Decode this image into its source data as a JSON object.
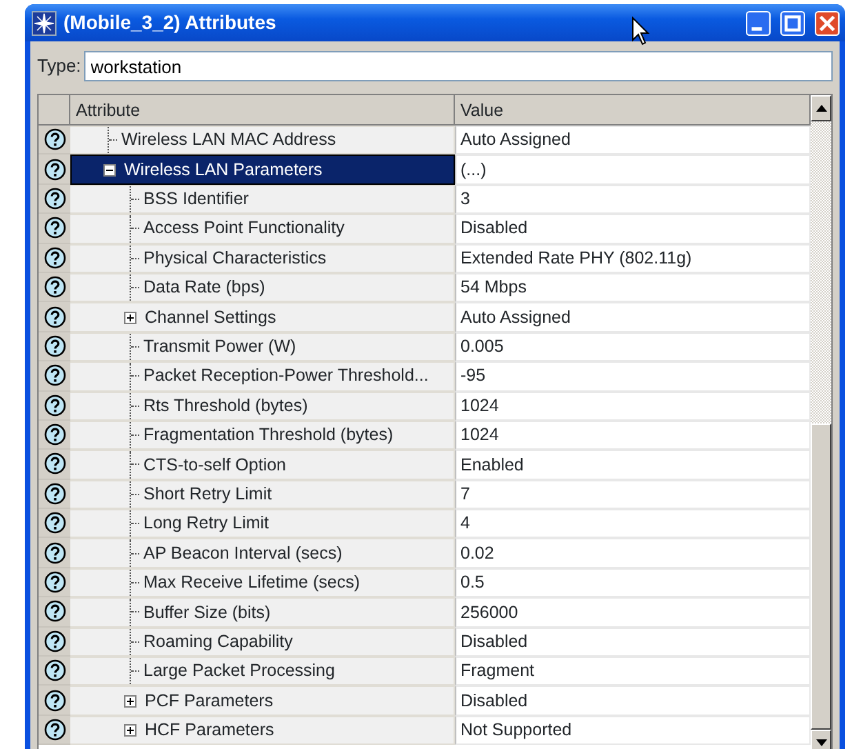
{
  "window": {
    "title": "(Mobile_3_2) Attributes"
  },
  "type_field": {
    "label": "Type:",
    "value": "workstation"
  },
  "table": {
    "columns": [
      "Attribute",
      "Value"
    ],
    "rows": [
      {
        "kind": "leaf",
        "name": "Wireless LAN MAC Address",
        "value": "Auto Assigned",
        "selected": false
      },
      {
        "kind": "group",
        "name": "Wireless LAN Parameters",
        "value": "(...)",
        "selected": true,
        "expanded": true,
        "children": [
          {
            "kind": "leaf",
            "name": "BSS Identifier",
            "value": "3",
            "selected": false
          },
          {
            "kind": "leaf",
            "name": "Access Point Functionality",
            "value": "Disabled",
            "selected": false
          },
          {
            "kind": "leaf",
            "name": "Physical Characteristics",
            "value": "Extended Rate PHY (802.11g)",
            "selected": false
          },
          {
            "kind": "leaf",
            "name": "Data Rate (bps)",
            "value": "54 Mbps",
            "selected": false
          },
          {
            "kind": "group",
            "name": "Channel Settings",
            "value": "Auto Assigned",
            "selected": false,
            "expanded": false
          },
          {
            "kind": "leaf",
            "name": "Transmit Power (W)",
            "value": "0.005",
            "selected": false
          },
          {
            "kind": "leaf",
            "name": "Packet Reception-Power Threshold...",
            "value": "-95",
            "selected": false
          },
          {
            "kind": "leaf",
            "name": "Rts Threshold (bytes)",
            "value": "1024",
            "selected": false
          },
          {
            "kind": "leaf",
            "name": "Fragmentation Threshold (bytes)",
            "value": "1024",
            "selected": false
          },
          {
            "kind": "leaf",
            "name": "CTS-to-self Option",
            "value": "Enabled",
            "selected": false
          },
          {
            "kind": "leaf",
            "name": "Short Retry Limit",
            "value": "7",
            "selected": false
          },
          {
            "kind": "leaf",
            "name": "Long Retry Limit",
            "value": "4",
            "selected": false
          },
          {
            "kind": "leaf",
            "name": "AP Beacon Interval (secs)",
            "value": "0.02",
            "selected": false
          },
          {
            "kind": "leaf",
            "name": "Max Receive Lifetime (secs)",
            "value": "0.5",
            "selected": false
          },
          {
            "kind": "leaf",
            "name": "Buffer Size (bits)",
            "value": "256000",
            "selected": false
          },
          {
            "kind": "leaf",
            "name": "Roaming Capability",
            "value": "Disabled",
            "selected": false
          },
          {
            "kind": "leaf",
            "name": "Large Packet Processing",
            "value": "Fragment",
            "selected": false
          },
          {
            "kind": "group",
            "name": "PCF Parameters",
            "value": "Disabled",
            "selected": false,
            "expanded": false
          },
          {
            "kind": "group",
            "name": "HCF Parameters",
            "value": "Not Supported",
            "selected": false,
            "expanded": false
          }
        ]
      }
    ]
  }
}
